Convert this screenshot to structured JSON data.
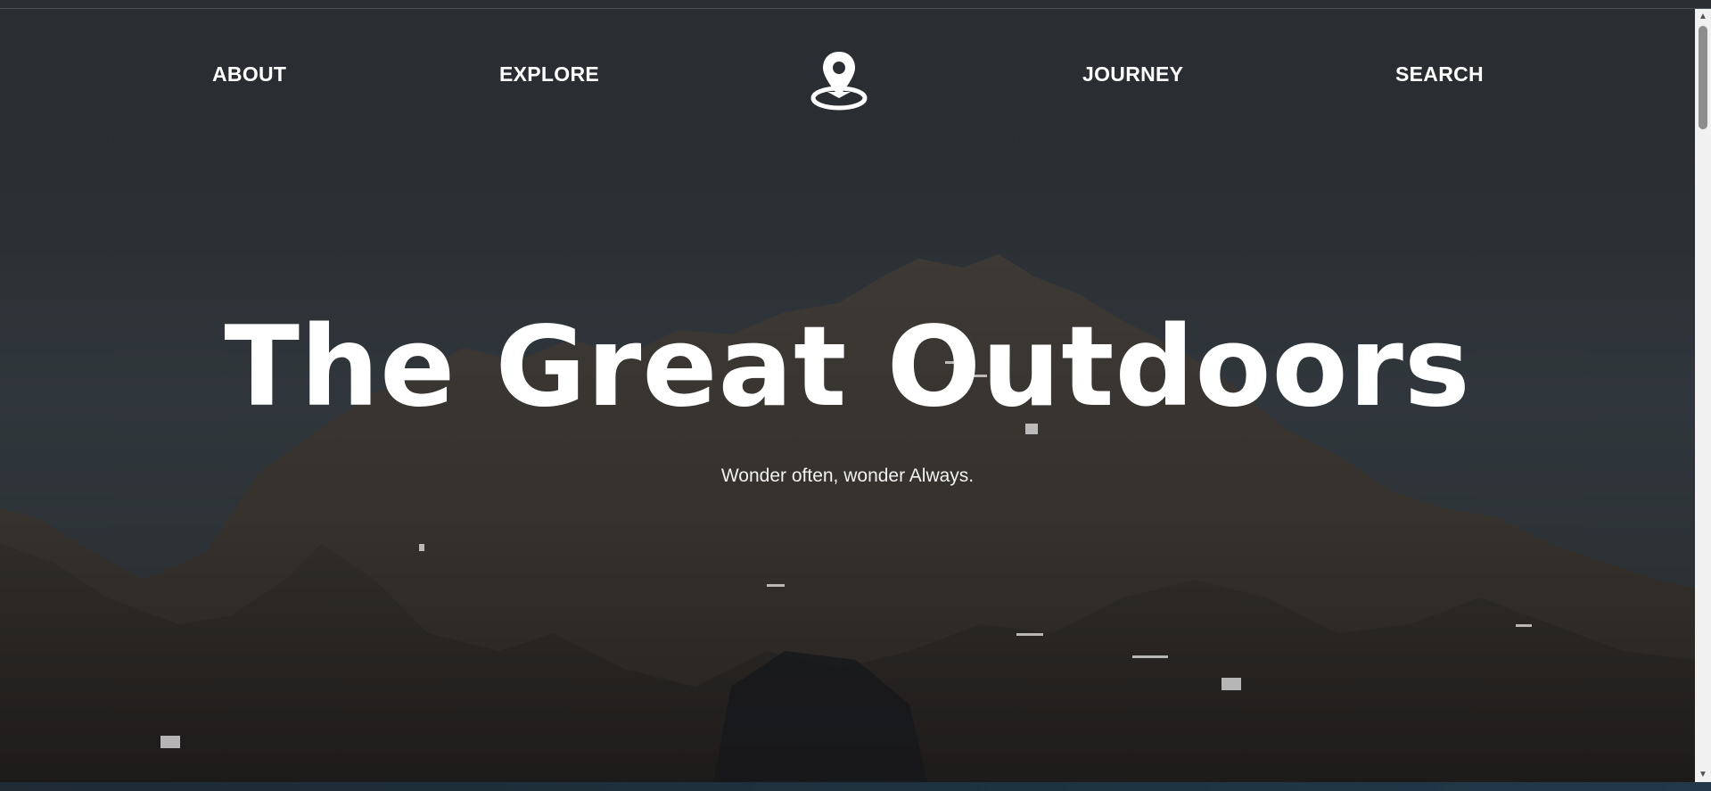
{
  "nav": {
    "left_items": [
      "ABOUT",
      "EXPLORE"
    ],
    "right_items": [
      "JOURNEY",
      "SEARCH"
    ],
    "logo_icon": "map-pin-icon"
  },
  "hero": {
    "title": "The Great Outdoors",
    "subtitle": "Wonder often, wonder Always."
  },
  "colors": {
    "text": "#ffffff",
    "sky_top": "#2a2d31",
    "mountain": "#3a3632"
  },
  "scrollbar": {
    "up_icon": "arrow-up-icon",
    "down_icon": "arrow-down-icon"
  }
}
